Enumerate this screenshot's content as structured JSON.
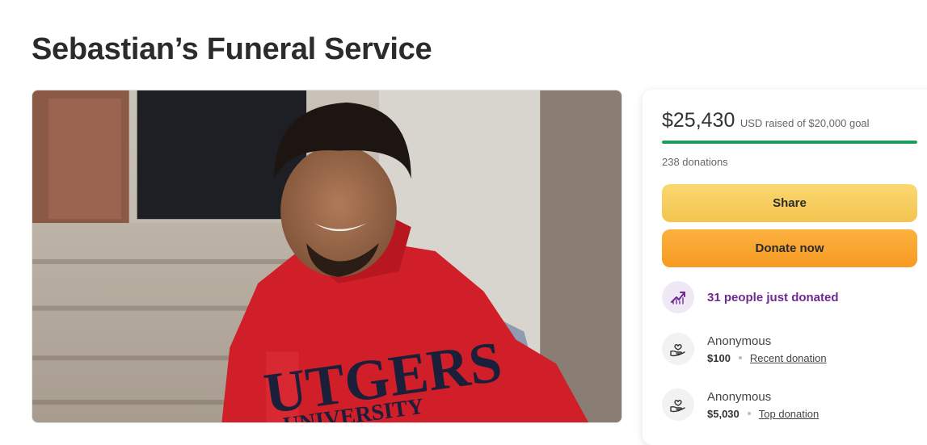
{
  "page": {
    "title": "Sebastian’s Funeral Service"
  },
  "campaign": {
    "raised_amount": "$25,430",
    "raised_rest": "USD raised of $20,000 goal",
    "progress_fraction": 1.0,
    "donations_count": "238 donations",
    "share_label": "Share",
    "donate_label": "Donate now",
    "trending": {
      "icon": "trending-up-icon",
      "label": "31 people just donated"
    },
    "donors": [
      {
        "icon": "heart-hand-icon",
        "name": "Anonymous",
        "amount": "$100",
        "tag": "Recent donation"
      },
      {
        "icon": "heart-hand-icon",
        "name": "Anonymous",
        "amount": "$5,030",
        "tag": "Top donation"
      }
    ]
  },
  "colors": {
    "progress": "#1d9d57",
    "share_button": "#f6c85a",
    "donate_button": "#f9a42e",
    "trending_text": "#6f2a91"
  }
}
